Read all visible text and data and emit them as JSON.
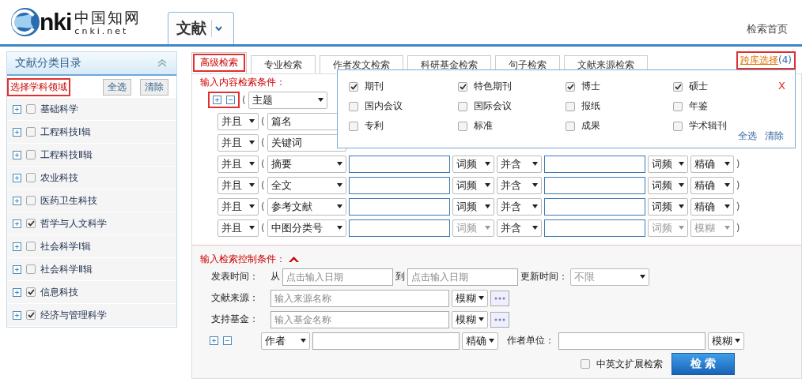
{
  "header": {
    "logo": {
      "wordmark": "nki",
      "chinese": "中国知网",
      "domain": "cnki.net"
    },
    "product": "文献",
    "home_link": "检索首页"
  },
  "sidebar": {
    "title": "文献分类目录",
    "subject_label": {
      "text": "选择学科领域",
      "highlighted": true
    },
    "buttons": [
      "全选",
      "清除"
    ],
    "items": [
      {
        "label": "基础科学",
        "checked": false
      },
      {
        "label": "工程科技Ⅰ辑",
        "checked": false
      },
      {
        "label": "工程科技Ⅱ辑",
        "checked": false
      },
      {
        "label": "农业科技",
        "checked": false
      },
      {
        "label": "医药卫生科技",
        "checked": false
      },
      {
        "label": "哲学与人文科学",
        "checked": true
      },
      {
        "label": "社会科学Ⅰ辑",
        "checked": false
      },
      {
        "label": "社会科学Ⅱ辑",
        "checked": false
      },
      {
        "label": "信息科技",
        "checked": true
      },
      {
        "label": "经济与管理科学",
        "checked": true
      }
    ]
  },
  "tabs": [
    {
      "label": "高级检索",
      "selected": true,
      "highlighted": true
    },
    {
      "label": "专业检索",
      "selected": false,
      "highlighted": false
    },
    {
      "label": "作者发文检索",
      "selected": false,
      "highlighted": false
    },
    {
      "label": "科研基金检索",
      "selected": false,
      "highlighted": false
    },
    {
      "label": "句子检索",
      "selected": false,
      "highlighted": false
    },
    {
      "label": "文献来源检索",
      "selected": false,
      "highlighted": false
    }
  ],
  "cross_db": {
    "label": "跨库选择",
    "count": "(4)",
    "highlighted": true
  },
  "content_conditions": {
    "title": "输入内容检索条件：",
    "add_remove_highlighted": true,
    "rows": [
      {
        "open": "(",
        "field": "主题"
      },
      {
        "logic": "并且",
        "open": "(",
        "field": "篇名"
      },
      {
        "logic": "并且",
        "open": "(",
        "field": "关键词"
      },
      {
        "logic": "并且",
        "open": "(",
        "field": "摘要",
        "freq1": {
          "text": "词频",
          "disabled": false
        },
        "op": "并含",
        "freq2": {
          "text": "词频",
          "disabled": false
        },
        "match": {
          "text": "精确",
          "disabled": false
        },
        "close": ")"
      },
      {
        "logic": "并且",
        "open": "(",
        "field": "全文",
        "freq1": {
          "text": "词频",
          "disabled": false
        },
        "op": "并含",
        "freq2": {
          "text": "词频",
          "disabled": false
        },
        "match": {
          "text": "精确",
          "disabled": false
        },
        "close": ")"
      },
      {
        "logic": "并且",
        "open": "(",
        "field": "参考文献",
        "freq1": {
          "text": "词频",
          "disabled": false
        },
        "op": "并含",
        "freq2": {
          "text": "词频",
          "disabled": false
        },
        "match": {
          "text": "精确",
          "disabled": false
        },
        "close": ")"
      },
      {
        "logic": "并且",
        "open": "(",
        "field": "中图分类号",
        "freq1": {
          "text": "词频",
          "disabled": true
        },
        "op": "并含",
        "freq2": {
          "text": "词频",
          "disabled": true
        },
        "match": {
          "text": "模糊",
          "disabled": true
        },
        "close": ")"
      }
    ]
  },
  "control_conditions": {
    "title": "输入检索控制条件：",
    "pub_time": {
      "label": "发表时间：",
      "from": "从",
      "from_placeholder": "点击输入日期",
      "to": "到",
      "to_placeholder": "点击输入日期",
      "update_label": "更新时间：",
      "update_value": "不限"
    },
    "source": {
      "label": "文献来源：",
      "placeholder": "输入来源名称",
      "match": "模糊"
    },
    "fund": {
      "label": "支持基金：",
      "placeholder": "输入基金名称",
      "match": "模糊"
    },
    "author": {
      "field": "作者",
      "match": "精确",
      "org_label": "作者单位：",
      "org_match": "模糊"
    },
    "extend": {
      "label": "中英文扩展检索",
      "checked": false
    },
    "search_button": "检 索"
  },
  "db_popup": {
    "options": [
      {
        "label": "期刊",
        "checked": true
      },
      {
        "label": "特色期刊",
        "checked": true
      },
      {
        "label": "博士",
        "checked": true
      },
      {
        "label": "硕士",
        "checked": true
      },
      {
        "label": "国内会议",
        "checked": false
      },
      {
        "label": "国际会议",
        "checked": false
      },
      {
        "label": "报纸",
        "checked": false
      },
      {
        "label": "年鉴",
        "checked": false
      },
      {
        "label": "专利",
        "checked": false
      },
      {
        "label": "标准",
        "checked": false
      },
      {
        "label": "成果",
        "checked": false
      },
      {
        "label": "学术辑刊",
        "checked": false
      }
    ],
    "close": "X",
    "select_all": "全选",
    "clear": "清除"
  }
}
